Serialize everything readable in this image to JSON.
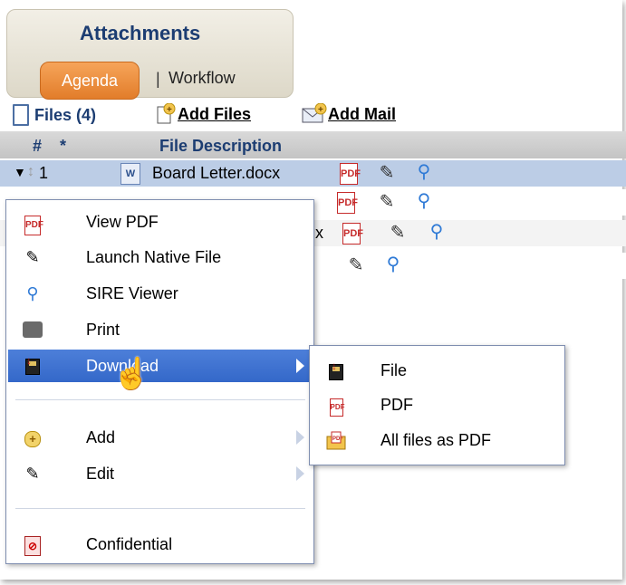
{
  "header": {
    "title": "Attachments",
    "tabs": [
      {
        "label": "Agenda",
        "active": true
      },
      {
        "label": "Workflow",
        "active": false
      }
    ],
    "tab_separator": "|"
  },
  "toolbar": {
    "files_label": "Files (4)",
    "add_files_label": "Add Files",
    "add_mail_label": "Add Mail"
  },
  "table": {
    "columns": [
      "#",
      "*",
      "File Description"
    ],
    "rows": [
      {
        "num": "1",
        "name": "Board Letter.docx"
      }
    ],
    "partial_suffix": "x"
  },
  "context_menu": {
    "items": [
      {
        "label": "View PDF",
        "icon": "pdf-icon"
      },
      {
        "label": "Launch Native File",
        "icon": "pencil-icon"
      },
      {
        "label": "SIRE Viewer",
        "icon": "magnifier-icon"
      },
      {
        "label": "Print",
        "icon": "printer-icon"
      },
      {
        "label": "Download",
        "icon": "floppy-download-icon",
        "highlighted": true,
        "submenu": true
      },
      {
        "label": "Add",
        "icon": "plus-icon",
        "submenu": true
      },
      {
        "label": "Edit",
        "icon": "pencil-icon",
        "submenu": true
      },
      {
        "label": "Confidential",
        "icon": "confidential-icon"
      }
    ]
  },
  "download_submenu": {
    "items": [
      {
        "label": "File",
        "icon": "floppy-download-icon"
      },
      {
        "label": "PDF",
        "icon": "pdf-download-icon"
      },
      {
        "label": "All files as PDF",
        "icon": "folder-pdf-icon"
      }
    ]
  },
  "colors": {
    "accent_orange": "#e27d2a",
    "title_blue": "#1c3d72",
    "highlight_blue": "#3f72d1",
    "selected_row": "#bccde6"
  }
}
